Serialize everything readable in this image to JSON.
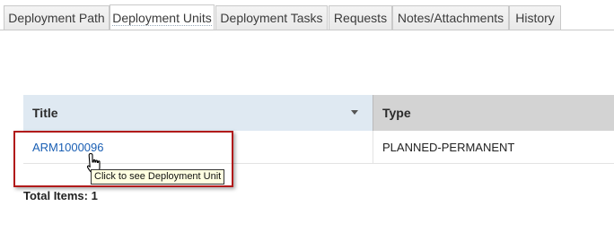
{
  "tabs": [
    {
      "label": "Deployment Path",
      "active": false
    },
    {
      "label": "Deployment Units",
      "active": true
    },
    {
      "label": "Deployment Tasks",
      "active": false
    },
    {
      "label": "Requests",
      "active": false
    },
    {
      "label": "Notes/Attachments",
      "active": false
    },
    {
      "label": "History",
      "active": false
    }
  ],
  "table": {
    "columns": [
      "Title",
      "Type"
    ],
    "rows": [
      {
        "title": "ARM1000096",
        "type": "PLANNED-PERMANENT"
      }
    ]
  },
  "tooltip": "Click to see Deployment Unit",
  "footer": {
    "total_label": "Total Items: 1"
  },
  "colors": {
    "link": "#1a5fb4",
    "highlight_border": "#b11a1a",
    "title_header_bg": "#dfe9f2",
    "type_header_bg": "#d3d3d3"
  }
}
